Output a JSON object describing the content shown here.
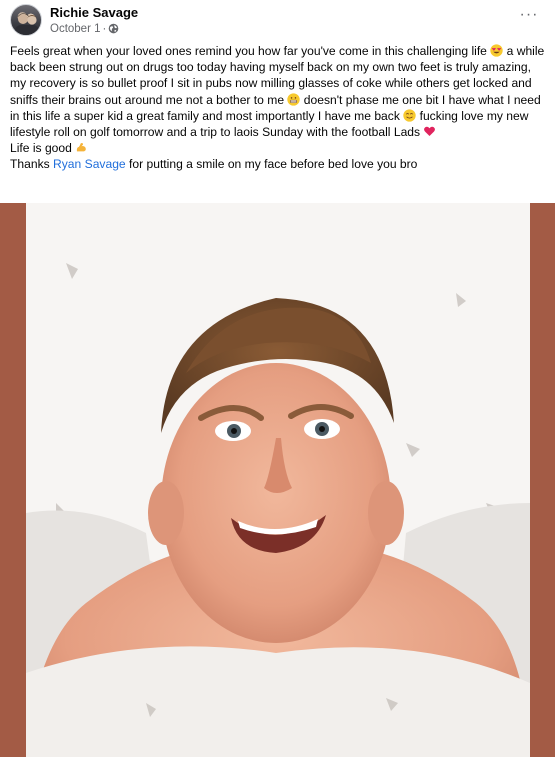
{
  "post": {
    "author": "Richie Savage",
    "date": "October 1",
    "separator": "·",
    "audience_icon": "globe-icon",
    "more_icon": "more-options-icon",
    "more_label": "···"
  },
  "body": {
    "para1_a": "Feels great when your loved ones remind you how far you've come in this challenging life ",
    "para1_b": " a while back been strung out on drugs too today having myself back on my own two feet is truly amazing, my recovery is so bullet proof I sit in pubs now milling glasses of coke while others get locked and sniffs their brains out around me not a bother to me ",
    "para1_c": " doesn't phase me one bit I have what I need in  this life a super kid a great family and most importantly I have me back ",
    "para1_d": " fucking love my new lifestyle roll on golf tomorrow and a trip to laois Sunday with the football Lads ",
    "line2": "Life is good ",
    "line3_a": "Thanks ",
    "mention": "Ryan Savage",
    "line3_b": " for putting a smile on my face before bed love you bro",
    "emojis": [
      "heart-eyes-emoji",
      "grimace-emoji",
      "smile-emoji",
      "red-heart-emoji",
      "flexed-bicep-emoji"
    ]
  },
  "photo": {
    "description_icon": "selfie-photo",
    "frame_color": "#a35b45"
  },
  "colors": {
    "mention": "#216fdb",
    "meta": "#65676b"
  }
}
